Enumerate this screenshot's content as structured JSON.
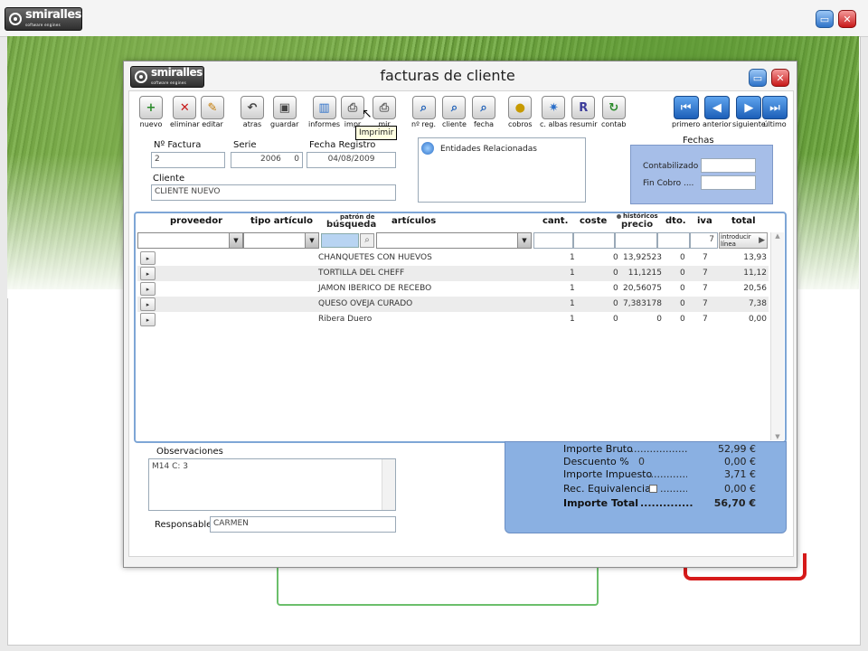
{
  "app": {
    "brand": "smiralles",
    "brand_tagline": "software engines"
  },
  "window": {
    "title": "facturas de cliente"
  },
  "toolbar": {
    "nuevo": "nuevo",
    "eliminar": "eliminar",
    "editar": "editar",
    "atras": "atras",
    "guardar": "guardar",
    "informes": "informes",
    "imprimir": "impr",
    "imprimir2": "mir",
    "nreg": "nº reg.",
    "cliente": "cliente",
    "fecha": "fecha",
    "cobros": "cobros",
    "calbas": "c. albas",
    "resumir": "resumir",
    "contab": "contab",
    "primero": "primero",
    "anterior": "anterior",
    "siguiente": "siguiente",
    "ultimo": "último"
  },
  "tooltip": "Imprimir",
  "form": {
    "nfactura_label": "Nº Factura",
    "nfactura": "2",
    "serie_label": "Serie",
    "serie_a": "2006",
    "serie_b": "0",
    "fecha_label": "Fecha Registro",
    "fecha": "04/08/2009",
    "cliente_label": "Cliente",
    "cliente": "CLIENTE NUEVO",
    "entidades": "Entidades Relacionadas"
  },
  "fechas": {
    "title": "Fechas",
    "contabilizado": "Contabilizado",
    "fin_cobro": "Fin Cobro ...."
  },
  "grid": {
    "headers": {
      "proveedor": "proveedor",
      "tipo": "tipo artículo",
      "patron_top": "patrón de",
      "patron": "búsqueda",
      "articulos": "artículos",
      "cant": "cant.",
      "coste": "coste",
      "historicos": "históricos",
      "precio": "precio",
      "dto": "dto.",
      "iva": "iva",
      "total": "total"
    },
    "input_iva": "7",
    "introducir": [
      "introducir",
      "línea"
    ],
    "rows": [
      {
        "articulo": "CHANQUETES CON HUEVOS",
        "cant": "1",
        "coste": "0",
        "precio": "13,92523",
        "dto": "0",
        "iva": "7",
        "total": "13,93"
      },
      {
        "articulo": "TORTILLA DEL CHEFF",
        "cant": "1",
        "coste": "0",
        "precio": "11,1215",
        "dto": "0",
        "iva": "7",
        "total": "11,12"
      },
      {
        "articulo": "JAMON IBERICO DE RECEBO",
        "cant": "1",
        "coste": "0",
        "precio": "20,56075",
        "dto": "0",
        "iva": "7",
        "total": "20,56"
      },
      {
        "articulo": "QUESO OVEJA CURADO",
        "cant": "1",
        "coste": "0",
        "precio": "7,383178",
        "dto": "0",
        "iva": "7",
        "total": "7,38"
      },
      {
        "articulo": "Ribera Duero",
        "cant": "1",
        "coste": "0",
        "precio": "0",
        "dto": "0",
        "iva": "7",
        "total": "0,00"
      }
    ]
  },
  "observaciones": {
    "label": "Observaciones",
    "value": "M14 C: 3"
  },
  "responsable": {
    "label": "Responsable",
    "value": "CARMEN"
  },
  "totals": {
    "bruto_label": "Importe Bruto",
    "bruto": "52,99 €",
    "descuento_label": "Descuento %",
    "descuento_pct": "0",
    "descuento": "0,00 €",
    "impuesto_label": "Importe Impuesto",
    "impuesto": "3,71 €",
    "rec_label": "Rec. Equivalencia",
    "rec": "0,00 €",
    "total_label": "Importe Total",
    "total": "56,70 €"
  },
  "colors": {
    "accent": "#8ab0e2",
    "nav": "#1c5fb8",
    "close": "#c81818"
  }
}
